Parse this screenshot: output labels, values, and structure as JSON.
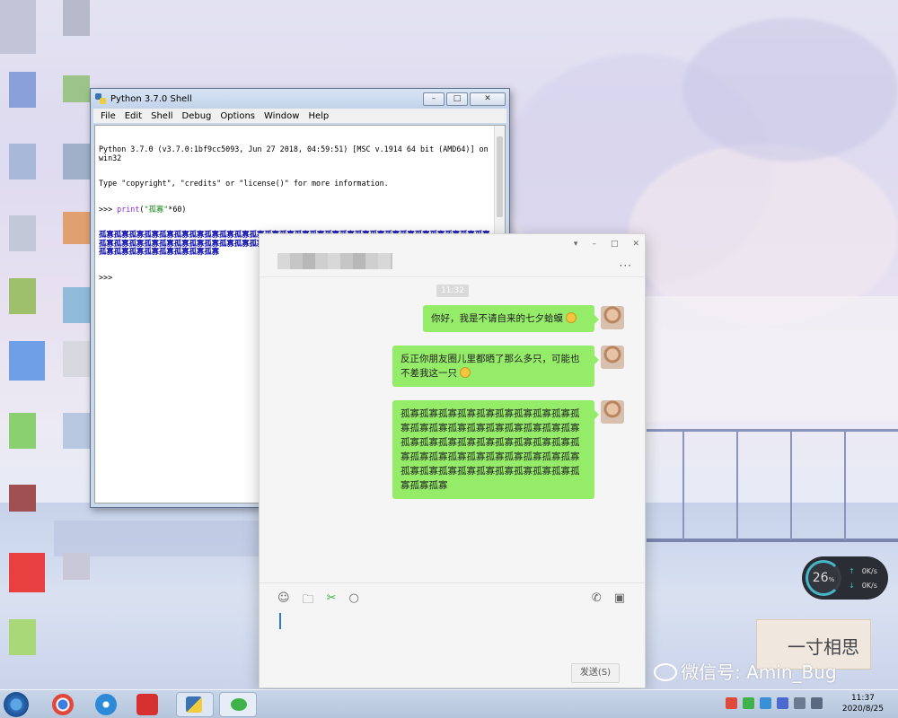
{
  "python_shell": {
    "title": "Python 3.7.0 Shell",
    "menu": [
      "File",
      "Edit",
      "Shell",
      "Debug",
      "Options",
      "Window",
      "Help"
    ],
    "banner_line1": "Python 3.7.0 (v3.7.0:1bf9cc5093, Jun 27 2018, 04:59:51) [MSC v.1914 64 bit (AMD64)] on win32",
    "banner_line2": "Type \"copyright\", \"credits\" or \"license()\" for more information.",
    "prompt": ">>> ",
    "command_keyword": "print",
    "command_open": "(",
    "command_string": "\"孤寡\"",
    "command_rest": "*60)",
    "output": "孤寡孤寡孤寡孤寡孤寡孤寡孤寡孤寡孤寡孤寡孤寡孤寡孤寡孤寡孤寡孤寡孤寡孤寡孤寡孤寡孤寡孤寡孤寡孤寡孤寡孤寡孤寡孤寡孤寡孤寡孤寡孤寡孤寡孤寡孤寡孤寡孤寡孤寡孤寡孤寡孤寡孤寡孤寡孤寡孤寡孤寡孤寡孤寡孤寡孤寡孤寡孤寡孤寡孤寡孤寡孤寡孤寡孤寡孤寡孤寡",
    "final_prompt": ">>>"
  },
  "wechat": {
    "time": "11:32",
    "messages": [
      {
        "text": "你好，我是不请自来的七夕蛤蟆"
      },
      {
        "text": "反正你朋友圈儿里都晒了那么多只，可能也不差我这一只"
      },
      {
        "text": "孤寡孤寡孤寡孤寡孤寡孤寡孤寡孤寡孤寡孤寡孤寡孤寡孤寡孤寡孤寡孤寡孤寡孤寡孤寡孤寡孤寡孤寡孤寡孤寡孤寡孤寡孤寡孤寡孤寡孤寡孤寡孤寡孤寡孤寡孤寡孤寡孤寡孤寡孤寡孤寡孤寡孤寡孤寡孤寡孤寡孤寡孤寡孤寡孤寡孤寡"
      }
    ],
    "send_label": "发送(S)",
    "more": "···"
  },
  "network_widget": {
    "percent": "26",
    "percent_unit": "%",
    "upload": "0K/s",
    "download": "0K/s"
  },
  "watermark": {
    "text": "微信号: Amin_Bug",
    "stamp_text": "一寸相思"
  },
  "clock": {
    "time": "11:37",
    "date": "2020/8/25"
  },
  "colors": {
    "bubble": "#95ec69",
    "python_output": "#1010b0",
    "net_accent": "#46b7c9"
  }
}
